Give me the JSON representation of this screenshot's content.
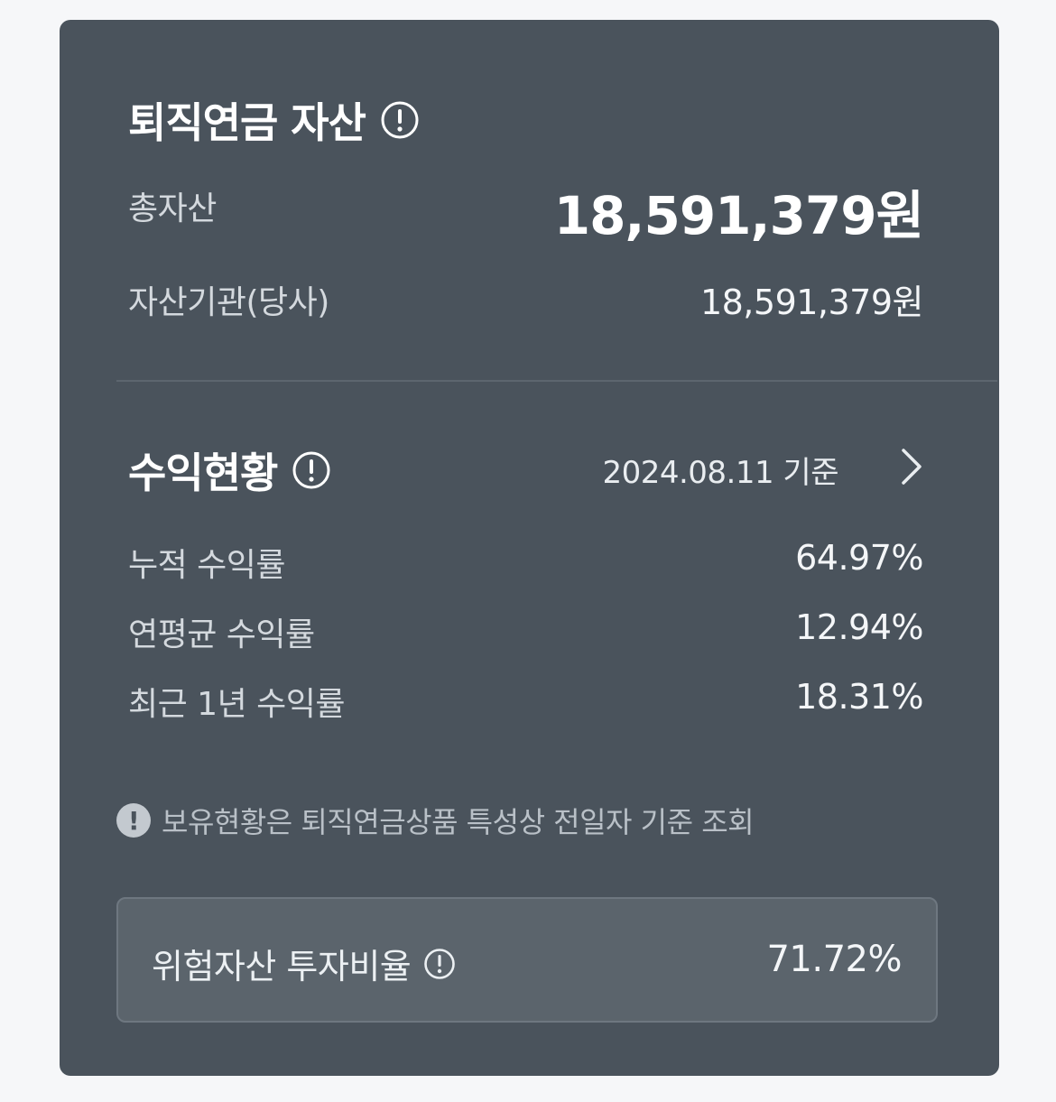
{
  "pension_assets": {
    "title": "퇴직연금 자산",
    "info_icon": "info-circle-icon",
    "total_label": "총자산",
    "total_value": "18,591,379원",
    "institution_label": "자산기관(당사)",
    "institution_value": "18,591,379원"
  },
  "returns": {
    "title": "수익현황",
    "info_icon": "info-circle-icon",
    "date": "2024.08.11 기준",
    "detail_icon": "chevron-right-icon",
    "rows": [
      {
        "label": "누적 수익률",
        "value": "64.97%"
      },
      {
        "label": "연평균 수익률",
        "value": "12.94%"
      },
      {
        "label": "최근 1년 수익률",
        "value": "18.31%"
      }
    ]
  },
  "notice": {
    "icon": "exclamation-icon",
    "text": "보유현황은 퇴직연금상품 특성상 전일자 기준 조회"
  },
  "risk_ratio": {
    "label": "위험자산 투자비율",
    "info_icon": "info-circle-icon",
    "value": "71.72%"
  },
  "colors": {
    "card_bg": "#4a535c",
    "page_bg": "#f6f7f9",
    "risk_box_bg": "#5b646c"
  }
}
